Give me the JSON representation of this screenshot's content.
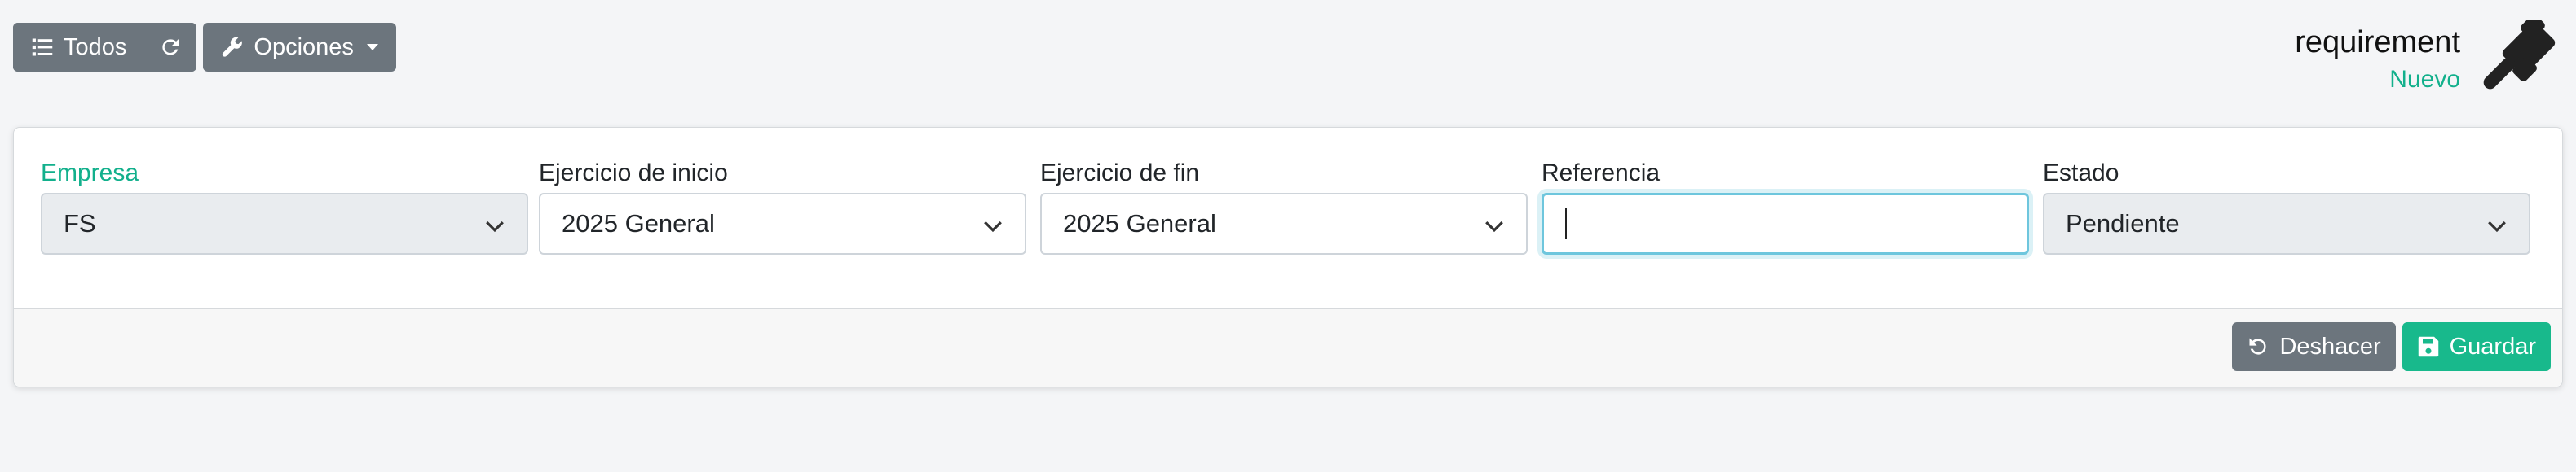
{
  "toolbar": {
    "todos_label": "Todos",
    "opciones_label": "Opciones"
  },
  "header": {
    "title": "requirement",
    "subtitle": "Nuevo"
  },
  "form": {
    "empresa": {
      "label": "Empresa",
      "value": "FS"
    },
    "ejercicio_inicio": {
      "label": "Ejercicio de inicio",
      "value": "2025 General"
    },
    "ejercicio_fin": {
      "label": "Ejercicio de fin",
      "value": "2025 General"
    },
    "referencia": {
      "label": "Referencia",
      "value": ""
    },
    "estado": {
      "label": "Estado",
      "value": "Pendiente"
    }
  },
  "footer": {
    "undo_label": "Deshacer",
    "save_label": "Guardar"
  },
  "colors": {
    "accent": "#12b08c",
    "button_secondary": "#6c757d",
    "button_success": "#18b98c",
    "focus_ring": "#6ec6dd"
  },
  "icons": {
    "list": "list-icon",
    "refresh": "refresh-icon",
    "wrench": "wrench-icon",
    "gavel": "gavel-icon",
    "chevron": "chevron-down-icon",
    "undo": "undo-icon",
    "save": "save-icon"
  }
}
